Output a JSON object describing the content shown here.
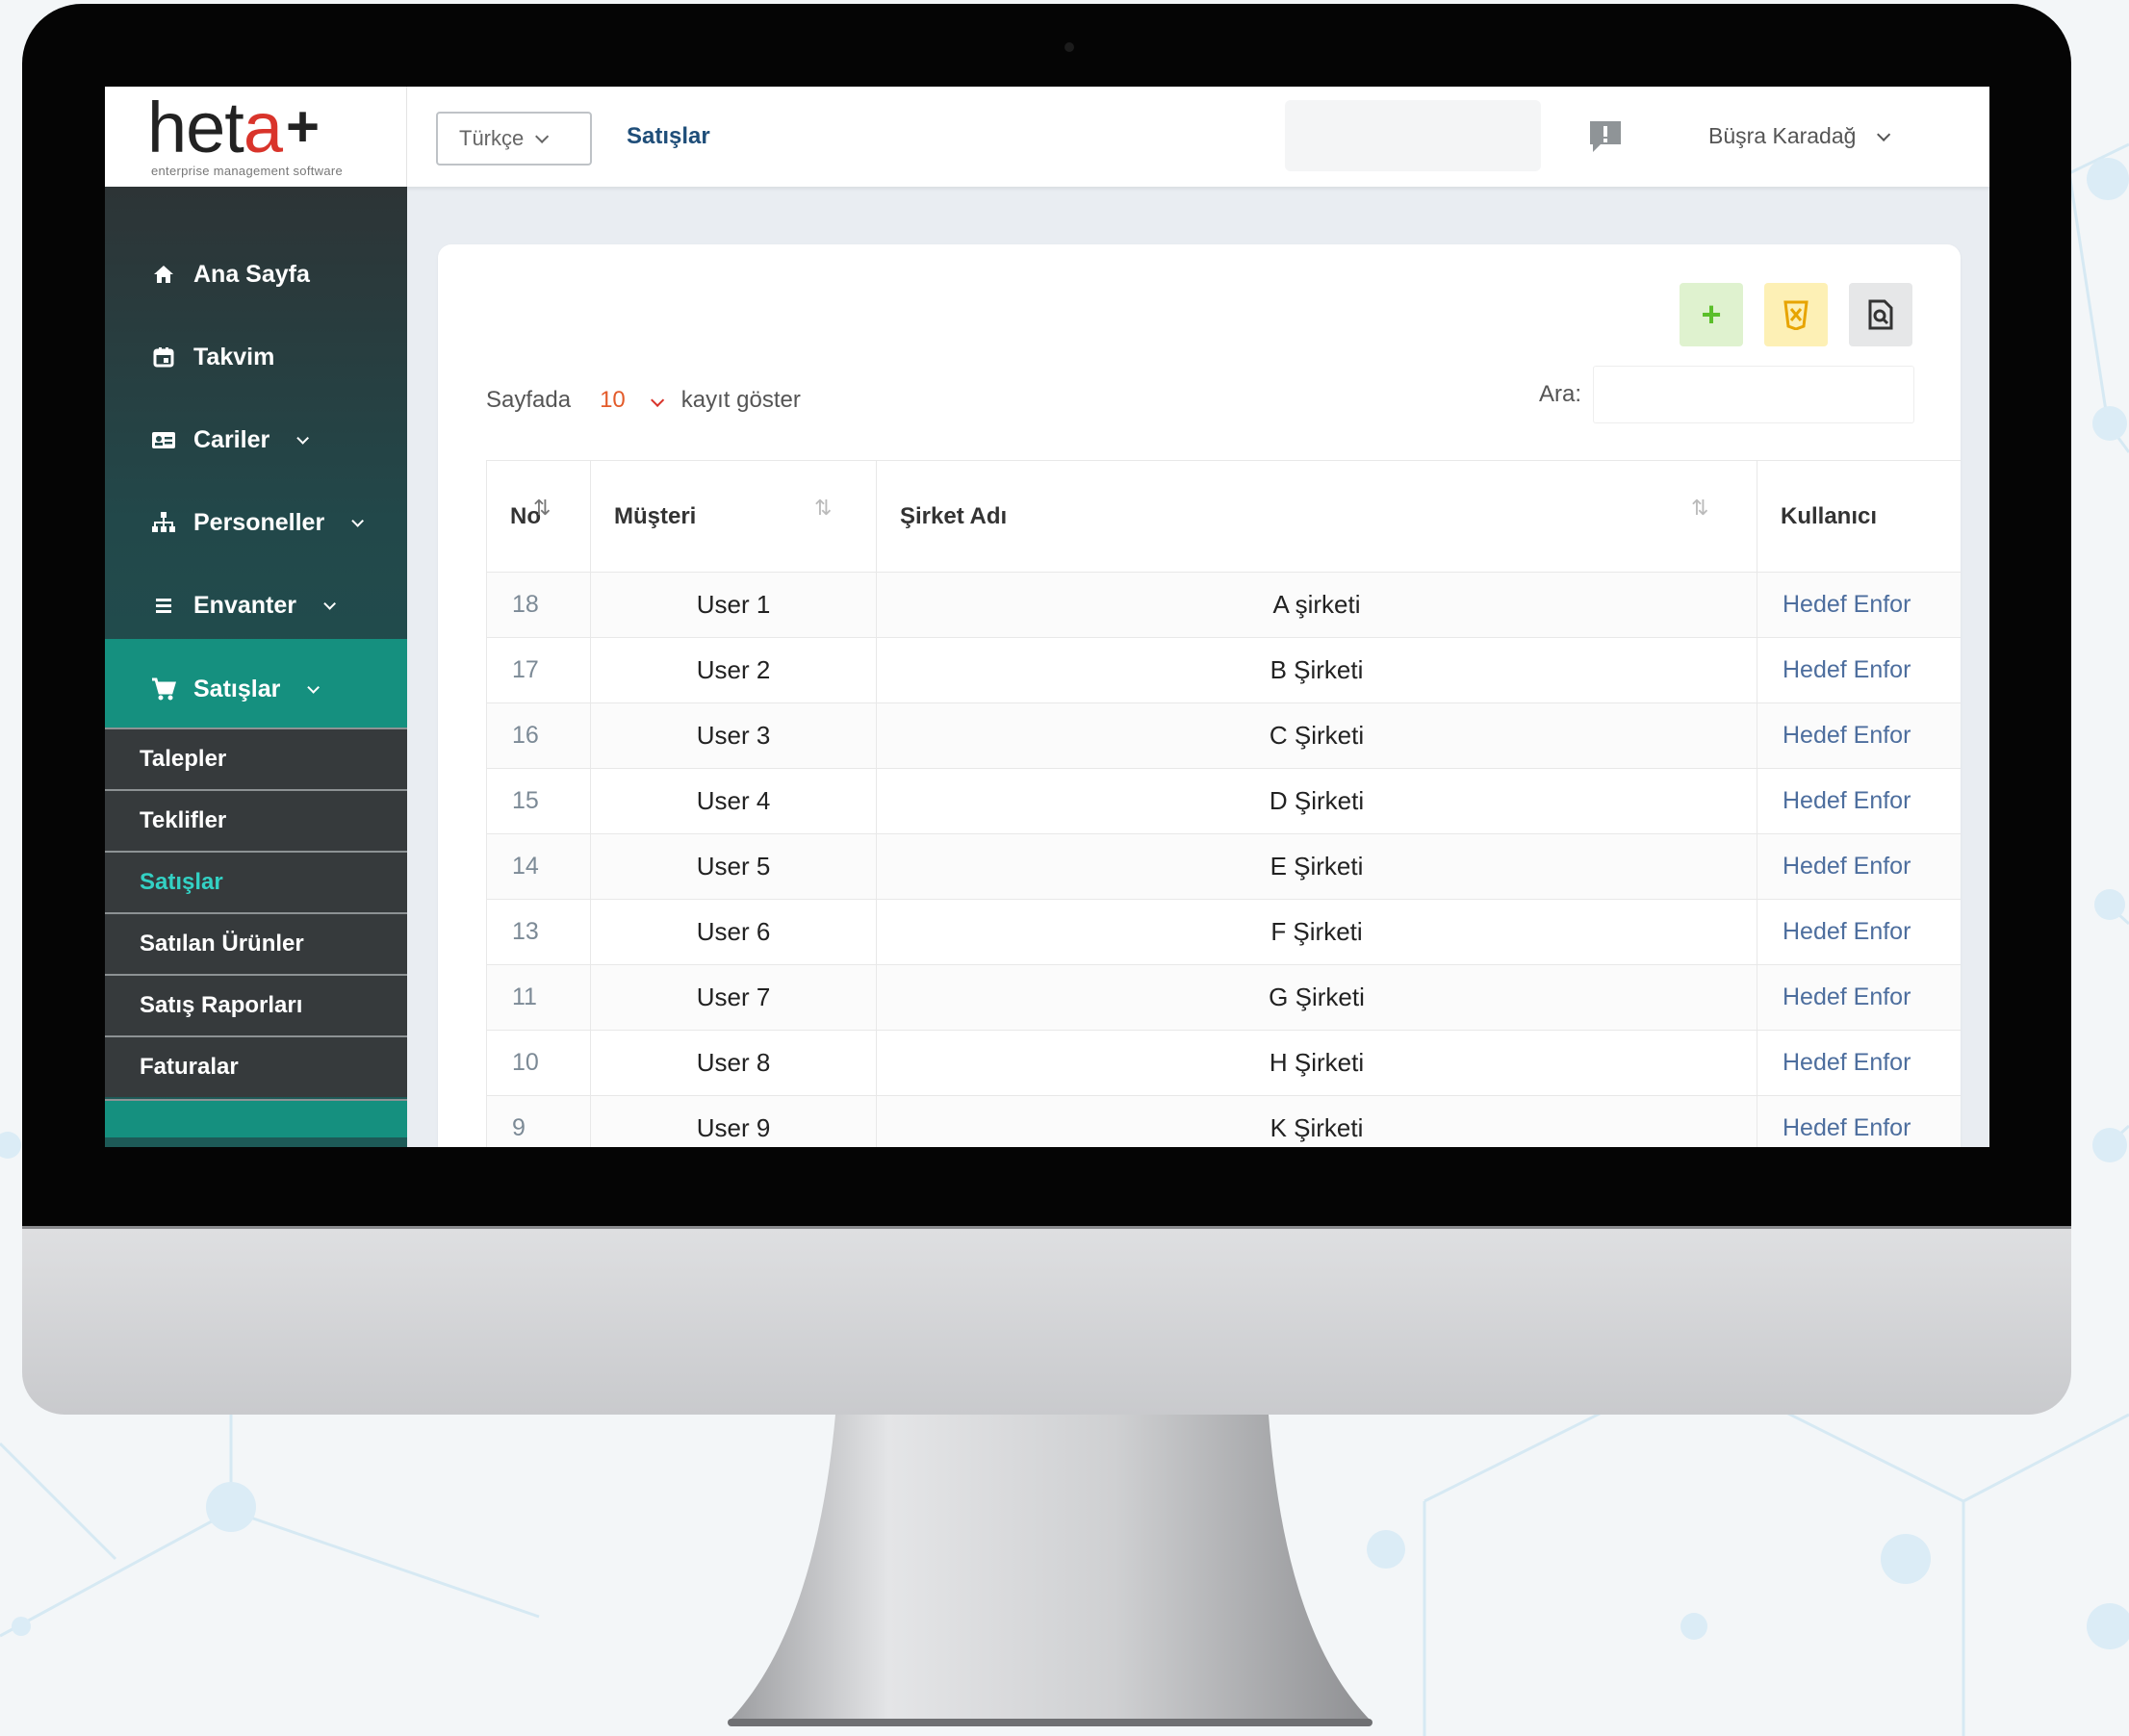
{
  "brand": {
    "logo_main": "het",
    "logo_accent": "a",
    "logo_plus": "+",
    "tagline": "enterprise management software",
    "accent_color": "#d9342b",
    "sidebar_active_color": "#15907f"
  },
  "header": {
    "language": "Türkçe",
    "page_title": "Satışlar",
    "notification_icon": "alert-message-icon",
    "user_name": "Büşra Karadağ"
  },
  "sidebar": {
    "items": [
      {
        "label": "Ana Sayfa",
        "icon": "home-icon"
      },
      {
        "label": "Takvim",
        "icon": "calendar-icon"
      },
      {
        "label": "Cariler",
        "icon": "contact-card-icon"
      },
      {
        "label": "Personeller",
        "icon": "org-chart-icon"
      },
      {
        "label": "Envanter",
        "icon": "list-icon"
      },
      {
        "label": "Satışlar",
        "icon": "cart-icon"
      }
    ],
    "submenu": [
      {
        "label": "Talepler"
      },
      {
        "label": "Teklifler"
      },
      {
        "label": "Satışlar"
      },
      {
        "label": "Satılan Ürünler"
      },
      {
        "label": "Satış Raporları"
      },
      {
        "label": "Faturalar"
      }
    ]
  },
  "toolbar": {
    "add_icon": "plus-icon",
    "excel_icon": "excel-export-icon",
    "preview_icon": "document-search-icon"
  },
  "table_controls": {
    "length_prefix": "Sayfada",
    "length_value": "10",
    "length_suffix": "kayıt göster",
    "search_label": "Ara:"
  },
  "table": {
    "columns": [
      "No",
      "Müşteri",
      "Şirket Adı",
      "Kullanıcı"
    ],
    "rows": [
      {
        "no": "18",
        "customer": "User 1",
        "company": "A şirketi",
        "user": "Hedef Enfor"
      },
      {
        "no": "17",
        "customer": "User 2",
        "company": "B Şirketi",
        "user": "Hedef Enfor"
      },
      {
        "no": "16",
        "customer": "User 3",
        "company": "C Şirketi",
        "user": "Hedef Enfor"
      },
      {
        "no": "15",
        "customer": "User 4",
        "company": "D Şirketi",
        "user": "Hedef Enfor"
      },
      {
        "no": "14",
        "customer": "User 5",
        "company": "E Şirketi",
        "user": "Hedef Enfor"
      },
      {
        "no": "13",
        "customer": "User 6",
        "company": "F Şirketi",
        "user": "Hedef Enfor"
      },
      {
        "no": "11",
        "customer": "User 7",
        "company": "G Şirketi",
        "user": "Hedef Enfor"
      },
      {
        "no": "10",
        "customer": "User 8",
        "company": "H Şirketi",
        "user": "Hedef Enfor"
      },
      {
        "no": "9",
        "customer": "User 9",
        "company": "K Şirketi",
        "user": "Hedef Enfor"
      }
    ]
  }
}
